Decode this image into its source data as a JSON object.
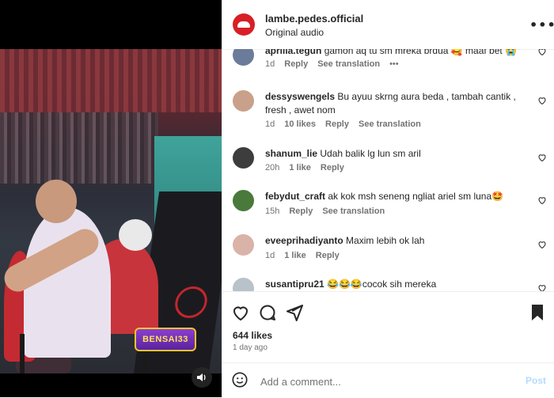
{
  "post": {
    "username": "lambe.pedes.official",
    "audio": "Original audio",
    "more_icon": "more-horizontal-icon",
    "likes": "644 likes",
    "time_ago": "1 day ago"
  },
  "media": {
    "watermark": "BENSAI33",
    "volume_icon": "volume-icon"
  },
  "comments": [
    {
      "user": "aprilia.teguh",
      "text": "gamon aq tu sm mreka brdua 🥰 maaf bet 😭",
      "time": "1d",
      "likes": "",
      "reply": "Reply",
      "translation": "See translation",
      "extra": "•••",
      "avatar_color": "#6a7c99"
    },
    {
      "user": "dessyswengels",
      "text": "Bu ayuu skrng aura beda , tambah cantik , fresh , awet nom",
      "time": "1d",
      "likes": "10 likes",
      "reply": "Reply",
      "translation": "See translation",
      "extra": "",
      "avatar_color": "#c9a08a"
    },
    {
      "user": "shanum_lie",
      "text": "Udah balik lg lun sm aril",
      "time": "20h",
      "likes": "1 like",
      "reply": "Reply",
      "translation": "",
      "extra": "",
      "avatar_color": "#3d3d3d"
    },
    {
      "user": "febydut_craft",
      "text": "ak kok msh seneng ngliat ariel sm luna🤩",
      "time": "15h",
      "likes": "",
      "reply": "Reply",
      "translation": "See translation",
      "extra": "",
      "avatar_color": "#4a7a3b"
    },
    {
      "user": "eveeprihadiyanto",
      "text": "Maxim lebih ok lah",
      "time": "1d",
      "likes": "1 like",
      "reply": "Reply",
      "translation": "",
      "extra": "",
      "avatar_color": "#d9b3a8"
    },
    {
      "user": "susantipru21",
      "text": "😂😂😂cocok sih mereka",
      "time": "",
      "likes": "",
      "reply": "",
      "translation": "",
      "extra": "",
      "avatar_color": "#b8c2c9"
    }
  ],
  "add_comment": {
    "placeholder": "Add a comment...",
    "post_label": "Post"
  },
  "colors": {
    "accent": "#0095f6",
    "brand_red": "#d81f26",
    "text": "#262626",
    "muted": "#737373"
  }
}
